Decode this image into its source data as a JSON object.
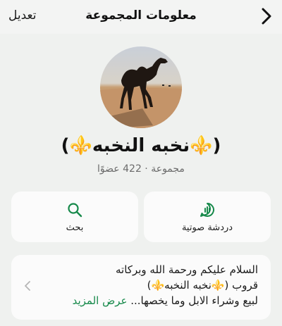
{
  "header": {
    "title": "معلومات المجموعة",
    "edit_label": "تعديل",
    "back_icon": "chevron-right-icon"
  },
  "group": {
    "name": "(⚜️نخبه النخبه⚜️)",
    "subtitle": "مجموعة · 422 عضوًا"
  },
  "actions": [
    {
      "label": "دردشة صوتية",
      "icon": "voice-chat-icon"
    },
    {
      "label": "بحث",
      "icon": "search-icon"
    }
  ],
  "description": {
    "lines": [
      "السلام عليكم ورحمة الله وبركاته",
      "قروب (⚜️نخبه النخبه⚜️)",
      "لبيع وشراء الابل وما يخصها..."
    ],
    "more_label": "عرض المزيد"
  },
  "colors": {
    "accent": "#16894a",
    "background": "#eff1ef",
    "card": "#fbfbfb"
  }
}
